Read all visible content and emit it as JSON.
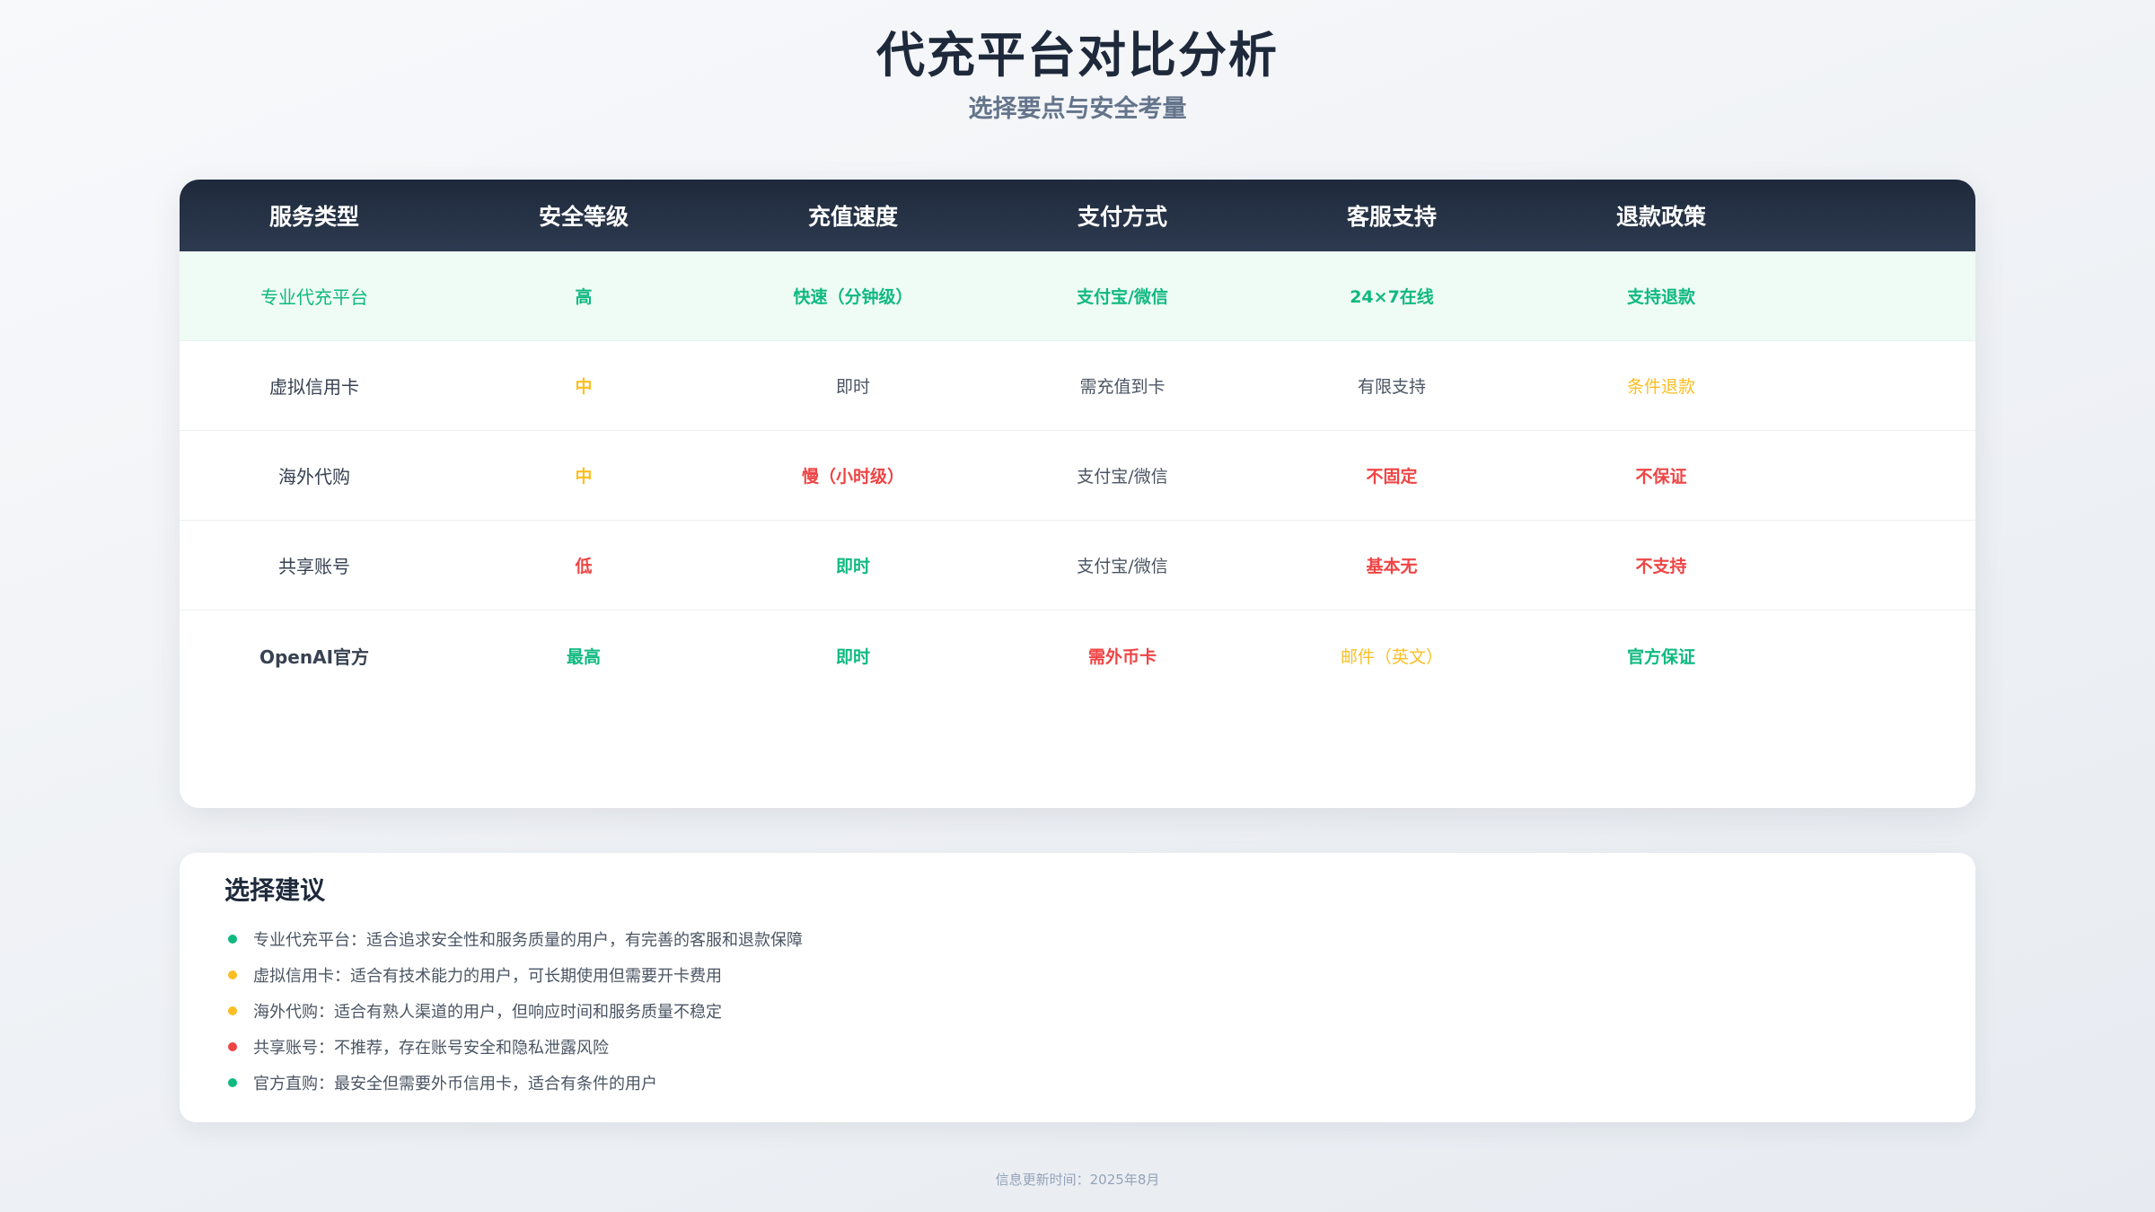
{
  "header": {
    "title": "代充平台对比分析",
    "subtitle": "选择要点与安全考量"
  },
  "table": {
    "columns": [
      "服务类型",
      "安全等级",
      "充值速度",
      "支付方式",
      "客服支持",
      "退款政策"
    ],
    "rows": [
      {
        "highlight": true,
        "cells": [
          {
            "text": "专业代充平台",
            "color": "green"
          },
          {
            "text": "高",
            "color": "green"
          },
          {
            "text": "快速（分钟级）",
            "color": "green"
          },
          {
            "text": "支付宝/微信",
            "color": "green"
          },
          {
            "text": "24×7在线",
            "color": "green"
          },
          {
            "text": "支持退款",
            "color": "green"
          }
        ]
      },
      {
        "highlight": false,
        "cells": [
          {
            "text": "虚拟信用卡",
            "color": "dark"
          },
          {
            "text": "中",
            "color": "amber"
          },
          {
            "text": "即时",
            "color": "gray"
          },
          {
            "text": "需充值到卡",
            "color": "gray"
          },
          {
            "text": "有限支持",
            "color": "gray"
          },
          {
            "text": "条件退款",
            "color": "amber"
          }
        ]
      },
      {
        "highlight": false,
        "cells": [
          {
            "text": "海外代购",
            "color": "dark"
          },
          {
            "text": "中",
            "color": "amber"
          },
          {
            "text": "慢（小时级）",
            "color": "red"
          },
          {
            "text": "支付宝/微信",
            "color": "gray"
          },
          {
            "text": "不固定",
            "color": "red"
          },
          {
            "text": "不保证",
            "color": "red"
          }
        ]
      },
      {
        "highlight": false,
        "cells": [
          {
            "text": "共享账号",
            "color": "dark"
          },
          {
            "text": "低",
            "color": "red"
          },
          {
            "text": "即时",
            "color": "green"
          },
          {
            "text": "支付宝/微信",
            "color": "gray"
          },
          {
            "text": "基本无",
            "color": "red"
          },
          {
            "text": "不支持",
            "color": "red"
          }
        ]
      },
      {
        "highlight": false,
        "cells": [
          {
            "text": "OpenAI官方",
            "color": "dark",
            "bold": true
          },
          {
            "text": "最高",
            "color": "green"
          },
          {
            "text": "即时",
            "color": "green"
          },
          {
            "text": "需外币卡",
            "color": "red"
          },
          {
            "text": "邮件（英文）",
            "color": "amber"
          },
          {
            "text": "官方保证",
            "color": "green"
          }
        ]
      }
    ]
  },
  "advice": {
    "title": "选择建议",
    "items": [
      {
        "text": "专业代充平台：适合追求安全性和服务质量的用户，有完善的客服和退款保障",
        "dot": "green"
      },
      {
        "text": "虚拟信用卡：适合有技术能力的用户，可长期使用但需要开卡费用",
        "dot": "amber"
      },
      {
        "text": "海外代购：适合有熟人渠道的用户，但响应时间和服务质量不稳定",
        "dot": "amber"
      },
      {
        "text": "共享账号：不推荐，存在账号安全和隐私泄露风险",
        "dot": "red"
      },
      {
        "text": "官方直购：最安全但需要外币信用卡，适合有条件的用户",
        "dot": "green"
      }
    ]
  },
  "colors": {
    "green": "#10b981",
    "amber": "#fbbf24",
    "red": "#ef4444",
    "header_bg": "#1e293b"
  },
  "footer": {
    "text": "信息更新时间：2025年8月"
  }
}
